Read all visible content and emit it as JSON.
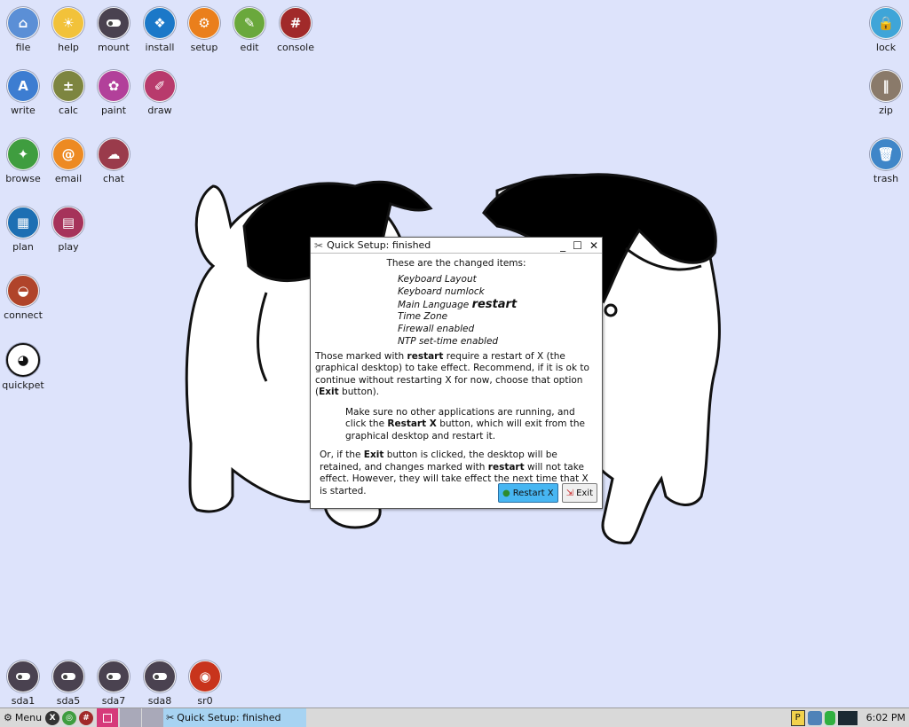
{
  "desktop": {
    "icons_left": [
      {
        "label": "file",
        "icon": "folder-home-icon",
        "color": "#5b8fd6"
      },
      {
        "label": "help",
        "icon": "lightbulb-icon",
        "color": "#f2c23a"
      },
      {
        "label": "mount",
        "icon": "toggle-icon",
        "color": "#4a4250"
      },
      {
        "label": "install",
        "icon": "dropbox-box-icon",
        "color": "#1b78c8"
      },
      {
        "label": "setup",
        "icon": "gear-icon",
        "color": "#ea7f1c"
      },
      {
        "label": "edit",
        "icon": "pencil-icon",
        "color": "#6aa83c"
      },
      {
        "label": "console",
        "icon": "console-hash-icon",
        "color": "#a12a2a"
      },
      {
        "label": "write",
        "icon": "write-icon",
        "color": "#3d7dd1"
      },
      {
        "label": "calc",
        "icon": "calculator-icon",
        "color": "#7d8540"
      },
      {
        "label": "paint",
        "icon": "palette-icon",
        "color": "#b2409a"
      },
      {
        "label": "draw",
        "icon": "draw-icon",
        "color": "#b83a6c"
      },
      {
        "label": "browse",
        "icon": "compass-icon",
        "color": "#3f9d3f"
      },
      {
        "label": "email",
        "icon": "at-sign-icon",
        "color": "#ed8a22"
      },
      {
        "label": "chat",
        "icon": "chat-icon",
        "color": "#9a3b4b"
      },
      {
        "label": "plan",
        "icon": "calendar-icon",
        "color": "#1d6fb3"
      },
      {
        "label": "play",
        "icon": "clapper-icon",
        "color": "#a6335a"
      },
      {
        "label": "connect",
        "icon": "satellite-dish-icon",
        "color": "#b0442a"
      },
      {
        "label": "quickpet",
        "icon": "quickpet-dog-icon",
        "color": "#ffffff"
      }
    ],
    "icons_right": [
      {
        "label": "lock",
        "icon": "padlock-icon",
        "color": "#3fa5d8"
      },
      {
        "label": "zip",
        "icon": "zipper-icon",
        "color": "#8a7a6a"
      },
      {
        "label": "trash",
        "icon": "trash-can-icon",
        "color": "#3f86c8"
      }
    ],
    "drives": [
      {
        "label": "sda1",
        "icon": "drive-toggle-icon",
        "color": "#4a4250"
      },
      {
        "label": "sda5",
        "icon": "drive-toggle-icon",
        "color": "#4a4250"
      },
      {
        "label": "sda7",
        "icon": "drive-toggle-icon",
        "color": "#4a4250"
      },
      {
        "label": "sda8",
        "icon": "drive-toggle-icon",
        "color": "#4a4250"
      },
      {
        "label": "sr0",
        "icon": "optical-drive-icon",
        "color": "#c8341c"
      }
    ]
  },
  "dialog": {
    "title": "Quick Setup: finished",
    "heading": "These are the changed items:",
    "items": [
      "Keyboard Layout",
      "Keyboard numlock",
      "Main Language",
      "Time Zone",
      "Firewall enabled",
      "NTP set-time enabled"
    ],
    "restart_tag": "restart",
    "para1": {
      "a": "Those marked with ",
      "b": "restart",
      "c": " require a restart of X (the graphical desktop) to take effect. Recommend, if it is ok to continue without restarting X for now, choose that option (",
      "d": "Exit",
      "e": " button)."
    },
    "para2": {
      "a": "Make sure no other applications are running, and click the ",
      "b": "Restart X",
      "c": " button, which will exit from the graphical desktop and restart it."
    },
    "para3": {
      "a": "Or, if the ",
      "b": "Exit",
      "c": " button is clicked, the desktop will be retained, and changes marked with ",
      "d": "restart",
      "e": " will not take effect. However, they will take effect the next time that X is started."
    },
    "buttons": {
      "restart": "Restart X",
      "exit": "Exit"
    }
  },
  "taskbar": {
    "menu_label": "Menu",
    "task_label": "Quick Setup: finished",
    "clock": "6:02 PM"
  },
  "colors": {
    "desktop_bg": "#dde3fb",
    "accent_button": "#47b6f2",
    "task_active": "#a7d3f2"
  }
}
